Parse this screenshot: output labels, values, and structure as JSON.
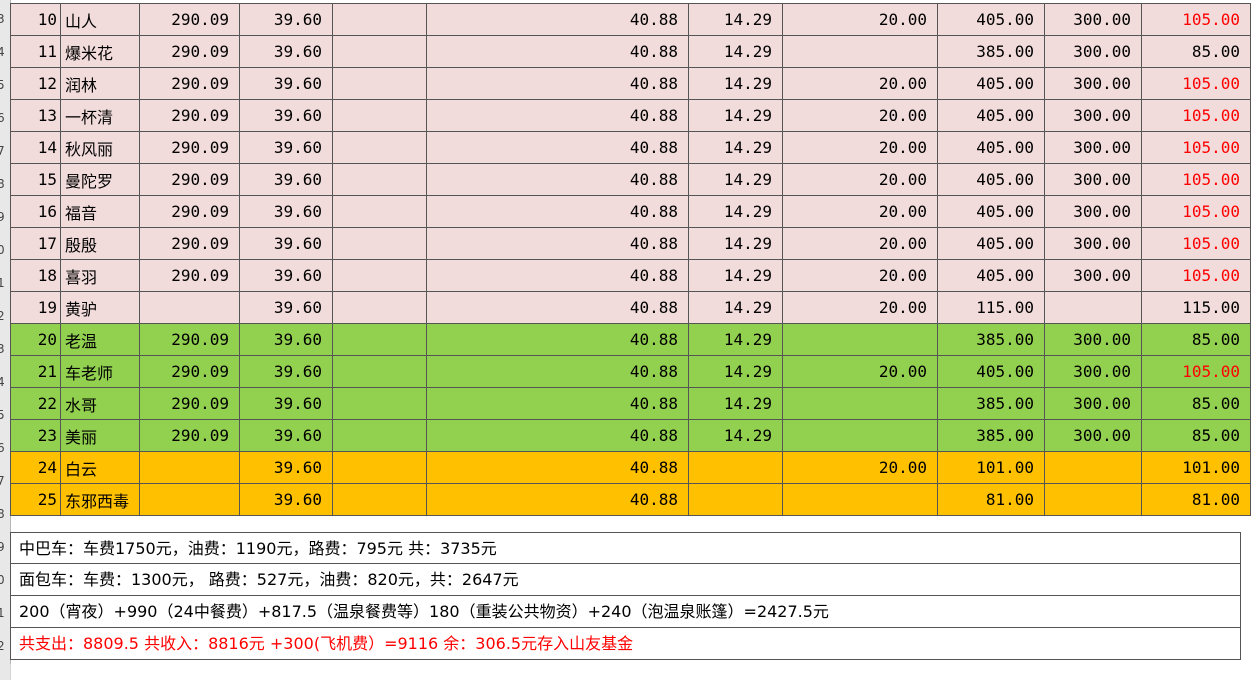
{
  "row_headers": [
    "3",
    "4",
    "5",
    "6",
    "7",
    "8",
    "9",
    "0",
    "1",
    "2",
    "3",
    "4",
    "5",
    "6",
    "7",
    "8",
    "9",
    "0",
    "1",
    "2"
  ],
  "rows": [
    {
      "style": "pink",
      "no": "10",
      "name": "山人",
      "c1": "290.09",
      "c2": "39.60",
      "c3": "",
      "c4": "40.88",
      "c5": "14.29",
      "c6": "20.00",
      "c7": "405.00",
      "c8": "300.00",
      "c9": "105.00",
      "c9_red": true
    },
    {
      "style": "pink",
      "no": "11",
      "name": "爆米花",
      "c1": "290.09",
      "c2": "39.60",
      "c3": "",
      "c4": "40.88",
      "c5": "14.29",
      "c6": "",
      "c7": "385.00",
      "c8": "300.00",
      "c9": "85.00",
      "c9_red": false
    },
    {
      "style": "pink",
      "no": "12",
      "name": "润林",
      "c1": "290.09",
      "c2": "39.60",
      "c3": "",
      "c4": "40.88",
      "c5": "14.29",
      "c6": "20.00",
      "c7": "405.00",
      "c8": "300.00",
      "c9": "105.00",
      "c9_red": true
    },
    {
      "style": "pink",
      "no": "13",
      "name": "一杯清",
      "c1": "290.09",
      "c2": "39.60",
      "c3": "",
      "c4": "40.88",
      "c5": "14.29",
      "c6": "20.00",
      "c7": "405.00",
      "c8": "300.00",
      "c9": "105.00",
      "c9_red": true
    },
    {
      "style": "pink",
      "no": "14",
      "name": "秋风丽",
      "c1": "290.09",
      "c2": "39.60",
      "c3": "",
      "c4": "40.88",
      "c5": "14.29",
      "c6": "20.00",
      "c7": "405.00",
      "c8": "300.00",
      "c9": "105.00",
      "c9_red": true
    },
    {
      "style": "pink",
      "no": "15",
      "name": "曼陀罗",
      "c1": "290.09",
      "c2": "39.60",
      "c3": "",
      "c4": "40.88",
      "c5": "14.29",
      "c6": "20.00",
      "c7": "405.00",
      "c8": "300.00",
      "c9": "105.00",
      "c9_red": true
    },
    {
      "style": "pink",
      "no": "16",
      "name": "福音",
      "c1": "290.09",
      "c2": "39.60",
      "c3": "",
      "c4": "40.88",
      "c5": "14.29",
      "c6": "20.00",
      "c7": "405.00",
      "c8": "300.00",
      "c9": "105.00",
      "c9_red": true
    },
    {
      "style": "pink",
      "no": "17",
      "name": "殷殷",
      "c1": "290.09",
      "c2": "39.60",
      "c3": "",
      "c4": "40.88",
      "c5": "14.29",
      "c6": "20.00",
      "c7": "405.00",
      "c8": "300.00",
      "c9": "105.00",
      "c9_red": true
    },
    {
      "style": "pink",
      "no": "18",
      "name": "喜羽",
      "c1": "290.09",
      "c2": "39.60",
      "c3": "",
      "c4": "40.88",
      "c5": "14.29",
      "c6": "20.00",
      "c7": "405.00",
      "c8": "300.00",
      "c9": "105.00",
      "c9_red": true
    },
    {
      "style": "pink",
      "no": "19",
      "name": "黄驴",
      "c1": "",
      "c2": "39.60",
      "c3": "",
      "c4": "40.88",
      "c5": "14.29",
      "c6": "20.00",
      "c7": "115.00",
      "c8": "",
      "c9": "115.00",
      "c9_red": false
    },
    {
      "style": "green",
      "no": "20",
      "name": "老温",
      "c1": "290.09",
      "c2": "39.60",
      "c3": "",
      "c4": "40.88",
      "c5": "14.29",
      "c6": "",
      "c7": "385.00",
      "c8": "300.00",
      "c9": "85.00",
      "c9_red": false
    },
    {
      "style": "green",
      "no": "21",
      "name": "车老师",
      "c1": "290.09",
      "c2": "39.60",
      "c3": "",
      "c4": "40.88",
      "c5": "14.29",
      "c6": "20.00",
      "c7": "405.00",
      "c8": "300.00",
      "c9": "105.00",
      "c9_red": true
    },
    {
      "style": "green",
      "no": "22",
      "name": "水哥",
      "c1": "290.09",
      "c2": "39.60",
      "c3": "",
      "c4": "40.88",
      "c5": "14.29",
      "c6": "",
      "c7": "385.00",
      "c8": "300.00",
      "c9": "85.00",
      "c9_red": false
    },
    {
      "style": "green",
      "no": "23",
      "name": "美丽",
      "c1": "290.09",
      "c2": "39.60",
      "c3": "",
      "c4": "40.88",
      "c5": "14.29",
      "c6": "",
      "c7": "385.00",
      "c8": "300.00",
      "c9": "85.00",
      "c9_red": false
    },
    {
      "style": "orange",
      "no": "24",
      "name": "白云",
      "c1": "",
      "c2": "39.60",
      "c3": "",
      "c4": "40.88",
      "c5": "",
      "c6": "20.00",
      "c7": "101.00",
      "c8": "",
      "c9": "101.00",
      "c9_red": false
    },
    {
      "style": "orange",
      "no": "25",
      "name": "东邪西毒",
      "c1": "",
      "c2": "39.60",
      "c3": "",
      "c4": "40.88",
      "c5": "",
      "c6": "",
      "c7": "81.00",
      "c8": "",
      "c9": "81.00",
      "c9_red": false
    }
  ],
  "notes": [
    {
      "text": "中巴车：车费1750元，油费：1190元，路费：795元     共：3735元",
      "red": false
    },
    {
      "text": "面包车：车费：1300元，   路费：527元，油费：820元，共：2647元",
      "red": false
    },
    {
      "text": "200（宵夜）+990（24中餐费）+817.5（温泉餐费等）180（重装公共物资）+240（泡温泉账篷）=2427.5元",
      "red": false
    },
    {
      "text": "共支出：8809.5     共收入：8816元 +300(飞机费）=9116   余：306.5元存入山友基金",
      "red": true
    }
  ],
  "colors": {
    "pink": "#f2dcdb",
    "green": "#92d050",
    "orange": "#ffc000",
    "red": "#ff0000"
  }
}
